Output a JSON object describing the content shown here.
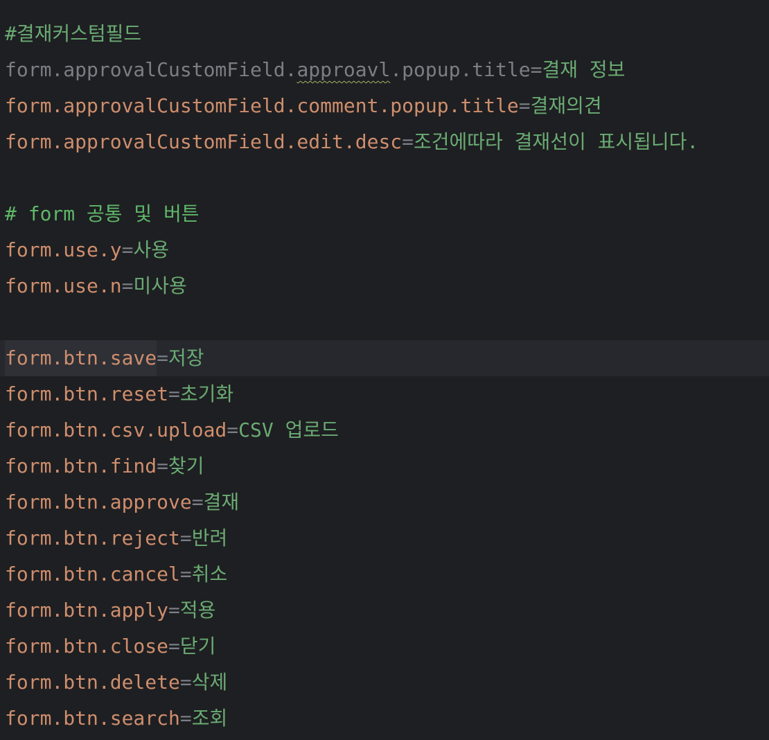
{
  "lines": [
    {
      "kind": "comment",
      "text": "#결재커스텀필드"
    },
    {
      "kind": "prop-dim",
      "key_a": "form.approvalCustomField.",
      "key_typo": "approavl",
      "key_b": ".popup.title",
      "sep": "=",
      "value": "결재 정보"
    },
    {
      "kind": "prop",
      "key": "form.approvalCustomField.comment.popup.title",
      "sep": "=",
      "value": "결재의견"
    },
    {
      "kind": "prop",
      "key": "form.approvalCustomField.edit.desc",
      "sep": "=",
      "value": "조건에따라 결재선이 표시됩니다."
    },
    {
      "kind": "blank"
    },
    {
      "kind": "comment",
      "text": "# form 공통 및 버튼"
    },
    {
      "kind": "prop",
      "key": "form.use.y",
      "sep": "=",
      "value": "사용"
    },
    {
      "kind": "prop",
      "key": "form.use.n",
      "sep": "=",
      "value": "미사용"
    },
    {
      "kind": "blank"
    },
    {
      "kind": "prop",
      "key": "form.btn.save",
      "sep": "=",
      "value": "저장",
      "current": true
    },
    {
      "kind": "prop",
      "key": "form.btn.reset",
      "sep": "=",
      "value": "초기화"
    },
    {
      "kind": "prop",
      "key": "form.btn.csv.upload",
      "sep": "=",
      "value": "CSV 업로드"
    },
    {
      "kind": "prop",
      "key": "form.btn.find",
      "sep": "=",
      "value": "찾기"
    },
    {
      "kind": "prop",
      "key": "form.btn.approve",
      "sep": "=",
      "value": "결재"
    },
    {
      "kind": "prop",
      "key": "form.btn.reject",
      "sep": "=",
      "value": "반려"
    },
    {
      "kind": "prop",
      "key": "form.btn.cancel",
      "sep": "=",
      "value": "취소"
    },
    {
      "kind": "prop",
      "key": "form.btn.apply",
      "sep": "=",
      "value": "적용"
    },
    {
      "kind": "prop",
      "key": "form.btn.close",
      "sep": "=",
      "value": "닫기"
    },
    {
      "kind": "prop",
      "key": "form.btn.delete",
      "sep": "=",
      "value": "삭제"
    },
    {
      "kind": "prop",
      "key": "form.btn.search",
      "sep": "=",
      "value": "조회"
    }
  ],
  "colors": {
    "background": "#1e1f22",
    "current_line": "#26282e",
    "comment": "#6aab73",
    "key": "#cf8e6d",
    "key_unused": "#7a7e85",
    "separator": "#7a7e85",
    "value": "#6aab73",
    "typo_underline": "#a9b665"
  }
}
